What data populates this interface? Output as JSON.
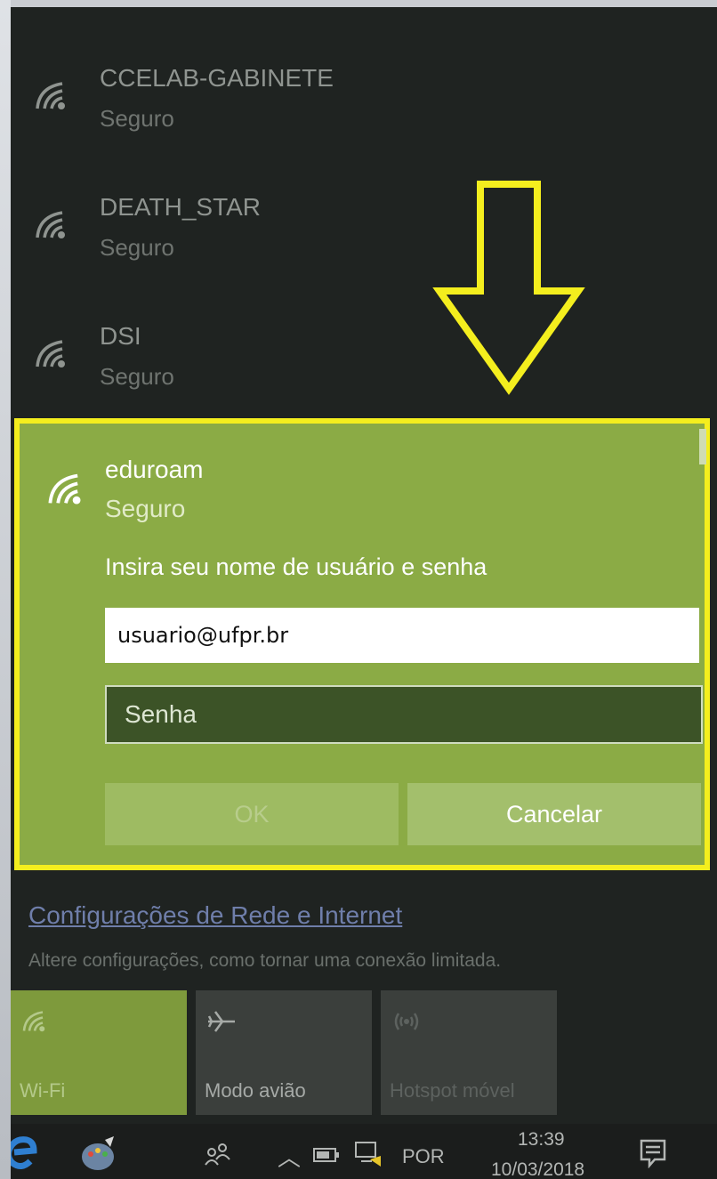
{
  "networks": [
    {
      "name": "CCELAB-GABINETE",
      "status": "Seguro"
    },
    {
      "name": "DEATH_STAR",
      "status": "Seguro"
    },
    {
      "name": "DSI",
      "status": "Seguro"
    }
  ],
  "selected": {
    "name": "eduroam",
    "status": "Seguro",
    "prompt": "Insira seu nome de usuário e senha",
    "username_value": "usuario@ufpr.br",
    "password_placeholder": "Senha",
    "ok_label": "OK",
    "cancel_label": "Cancelar"
  },
  "settings": {
    "link": "Configurações de Rede e Internet",
    "description": "Altere configurações, como tornar uma conexão limitada."
  },
  "quick_actions": [
    {
      "label": "Wi-Fi",
      "icon": "wifi-icon",
      "active": true
    },
    {
      "label": "Modo avião",
      "icon": "airplane-icon",
      "active": false
    },
    {
      "label": "Hotspot móvel",
      "icon": "hotspot-icon",
      "active": false
    }
  ],
  "taskbar": {
    "language": "POR",
    "time": "13:39",
    "date": "10/03/2018"
  },
  "colors": {
    "accent": "#8bab45",
    "highlight_border": "#f4ee1e",
    "panel_bg": "#1f2321"
  }
}
